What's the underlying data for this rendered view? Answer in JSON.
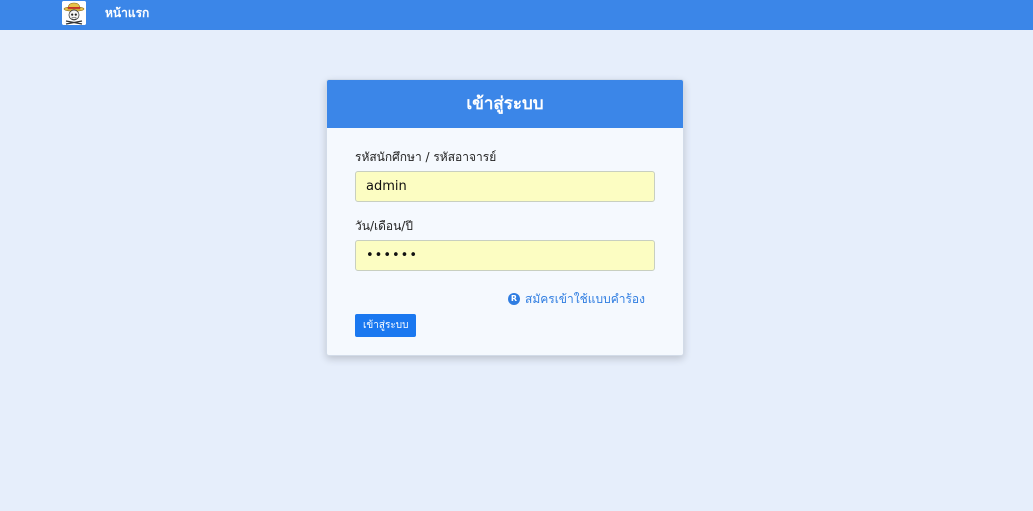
{
  "navbar": {
    "logo_icon": "straw-hat-skull-logo-icon",
    "home_label": "หน้าแรก",
    "background": "#3b86e8"
  },
  "login_card": {
    "title": "เข้าสู่ระบบ",
    "username_label": "รหัสนักศึกษา / รหัสอาจารย์",
    "username_value": "admin",
    "password_label": "วัน/เดือน/ปี",
    "password_value": "••••••",
    "register_icon": "registered-circle-icon",
    "register_link": "สมัครเข้าใช้แบบคำร้อง",
    "submit_label": "เข้าสู่ระบบ"
  },
  "colors": {
    "accent": "#3b86e8",
    "button": "#1a78f0",
    "input_autofill": "#fcfdc2",
    "page_background": "#e6eefb"
  }
}
